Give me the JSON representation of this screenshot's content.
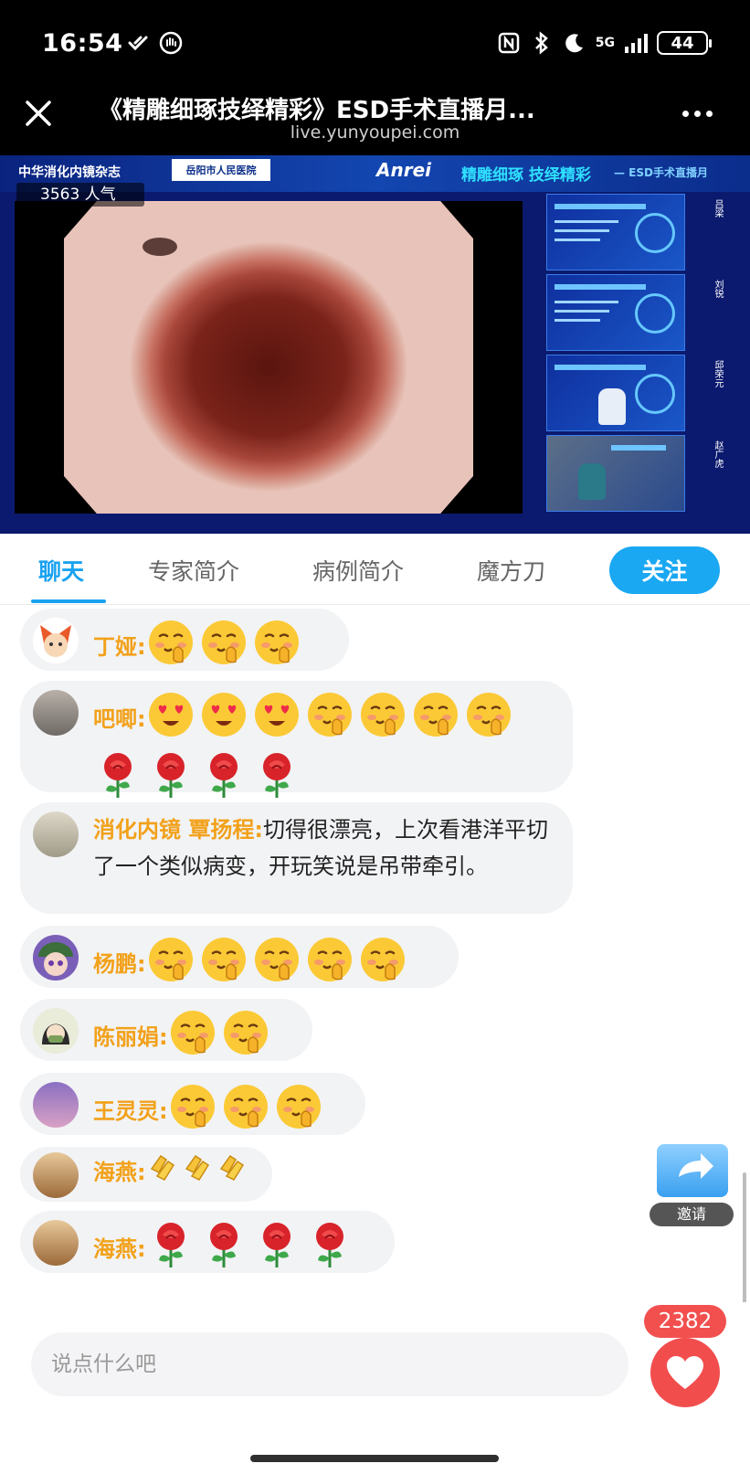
{
  "status_bar": {
    "time": "16:54",
    "network": "5G",
    "battery": "44",
    "icons": [
      "tiktok-icon",
      "notification-hand-icon",
      "nfc-icon",
      "bluetooth-icon",
      "moon-icon",
      "signal-icon",
      "battery-icon"
    ]
  },
  "title_bar": {
    "title": "《精雕细琢技绎精彩》ESD手术直播月...",
    "url": "live.yunyoupei.com"
  },
  "video": {
    "viewers": "3563 人气",
    "journal": "中华消化内镜杂志",
    "hospital": "岳阳市人民医院",
    "brand": "Anrei",
    "slogan": "精雕细琢 技绎精彩",
    "subtitle": "— ESD手术直播月",
    "side_names": [
      "吕梁",
      "刘锐",
      "邱荣元",
      "赵广虎"
    ]
  },
  "tabs": {
    "items": [
      "聊天",
      "专家简介",
      "病例简介",
      "魔方刀"
    ],
    "active": "聊天",
    "follow_label": "关注"
  },
  "chat": {
    "messages": [
      {
        "user": "丁娅:",
        "text": "",
        "emoji": [
          "shy-face",
          "shy-face",
          "shy-face"
        ]
      },
      {
        "user": "吧唧:",
        "text": "",
        "emoji": [
          "heart-eyes",
          "heart-eyes",
          "heart-eyes",
          "shy-face",
          "shy-face",
          "shy-face",
          "shy-face",
          "rose",
          "rose",
          "rose",
          "rose"
        ]
      },
      {
        "user": "消化内镜 覃扬程:",
        "text": "切得很漂亮，上次看港洋平切了一个类似病变，开玩笑说是吊带牵引。",
        "emoji": []
      },
      {
        "user": "杨鹏:",
        "text": "",
        "emoji": [
          "shy-face",
          "shy-face",
          "shy-face",
          "shy-face",
          "shy-face"
        ]
      },
      {
        "user": "陈丽娟:",
        "text": "",
        "emoji": [
          "shy-face",
          "shy-face"
        ]
      },
      {
        "user": "王灵灵:",
        "text": "",
        "emoji": [
          "shy-face",
          "shy-face",
          "shy-face"
        ]
      },
      {
        "user": "海燕:",
        "text": "",
        "emoji": [
          "clap",
          "clap",
          "clap"
        ]
      },
      {
        "user": "海燕:",
        "text": "",
        "emoji": [
          "rose",
          "rose",
          "rose",
          "rose"
        ]
      }
    ],
    "invite_label": "邀请"
  },
  "input_bar": {
    "placeholder": "说点什么吧",
    "like_count": "2382"
  },
  "colors": {
    "accent": "#1aa2f0",
    "username": "#f2a11a",
    "like": "#f24d4d"
  }
}
